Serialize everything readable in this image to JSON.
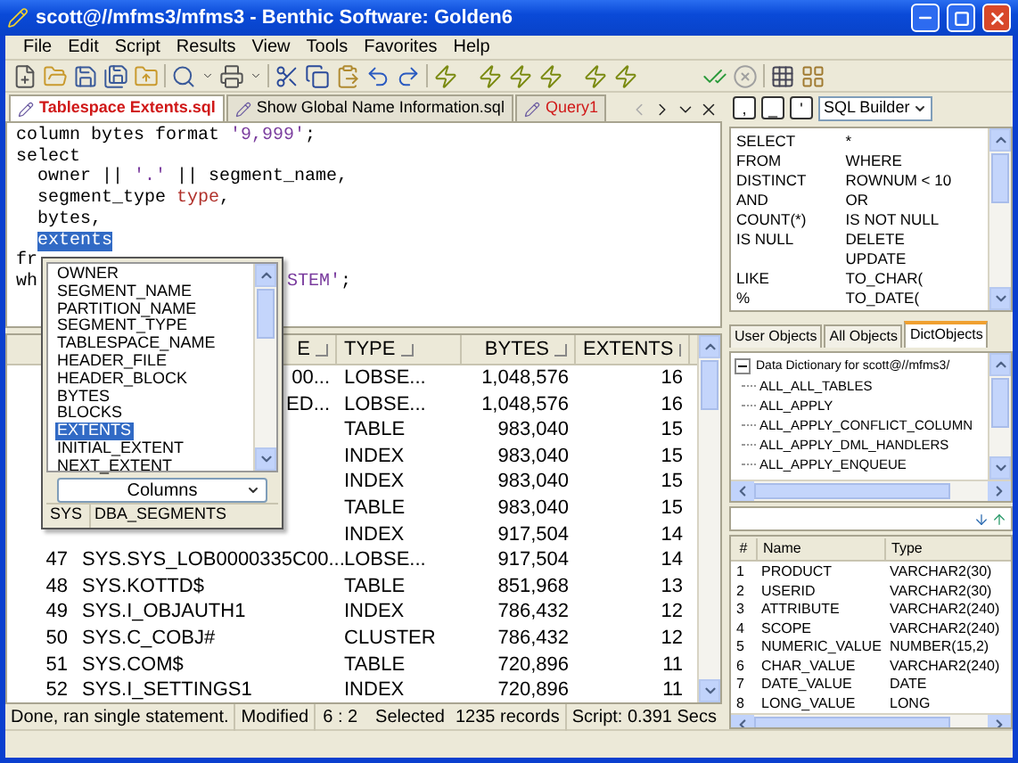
{
  "window": {
    "title": "scott@//mfms3/mfms3 - Benthic Software: Golden6"
  },
  "menu": [
    "File",
    "Edit",
    "Script",
    "Results",
    "View",
    "Tools",
    "Favorites",
    "Help"
  ],
  "editor_tabs": [
    {
      "label": "Tablespace Extents.sql",
      "selected": true,
      "modified": true
    },
    {
      "label": "Show Global Name Information.sql",
      "selected": false,
      "modified": false
    },
    {
      "label": "Query1",
      "selected": false,
      "modified": true
    }
  ],
  "editor": {
    "lines": [
      [
        {
          "text": "column bytes format ",
          "kind": "code"
        },
        {
          "text": "'9,999'",
          "kind": "string"
        },
        {
          "text": ";",
          "kind": "code"
        }
      ],
      [
        {
          "text": "select",
          "kind": "code"
        }
      ],
      [
        {
          "text": "  owner || ",
          "kind": "code"
        },
        {
          "text": "'.'",
          "kind": "string"
        },
        {
          "text": " || segment_name,",
          "kind": "code"
        }
      ],
      [
        {
          "text": "  segment_type ",
          "kind": "code"
        },
        {
          "text": "type",
          "kind": "alias"
        },
        {
          "text": ",",
          "kind": "code"
        }
      ],
      [
        {
          "text": "  bytes,",
          "kind": "code"
        }
      ],
      [
        {
          "text": "extents",
          "kind": "selected"
        }
      ],
      [
        {
          "text": "fr",
          "kind": "code"
        }
      ],
      [
        {
          "text": "wh",
          "kind": "code"
        },
        {
          "text": "STEM'",
          "kind": "tail"
        },
        {
          "text": ";",
          "kind": "code"
        }
      ]
    ]
  },
  "completion_popup": {
    "items": [
      {
        "label": "OWNER",
        "selected": false
      },
      {
        "label": "SEGMENT_NAME",
        "selected": false
      },
      {
        "label": "PARTITION_NAME",
        "selected": false
      },
      {
        "label": "SEGMENT_TYPE",
        "selected": false
      },
      {
        "label": "TABLESPACE_NAME",
        "selected": false
      },
      {
        "label": "HEADER_FILE",
        "selected": false
      },
      {
        "label": "HEADER_BLOCK",
        "selected": false
      },
      {
        "label": "BYTES",
        "selected": false
      },
      {
        "label": "BLOCKS",
        "selected": false
      },
      {
        "label": "EXTENTS",
        "selected": true
      },
      {
        "label": "INITIAL_EXTENT",
        "selected": false
      },
      {
        "label": "NEXT_EXTENT",
        "selected": false
      }
    ],
    "dropdown": "Columns",
    "owner": "SYS",
    "object": "DBA_SEGMENTS"
  },
  "results": {
    "columns": [
      "E",
      "TYPE",
      "BYTES",
      "EXTENTS"
    ],
    "rows": [
      {
        "segment_fragment": "00...",
        "type": "LOBSE...",
        "bytes": "1,048,576",
        "extents": "16"
      },
      {
        "segment_fragment": "ED...",
        "type": "LOBSE...",
        "bytes": "1,048,576",
        "extents": "16"
      },
      {
        "type": "TABLE",
        "bytes": "983,040",
        "extents": "15"
      },
      {
        "type": "INDEX",
        "bytes": "983,040",
        "extents": "15"
      },
      {
        "type": "INDEX",
        "bytes": "983,040",
        "extents": "15"
      },
      {
        "type": "TABLE",
        "bytes": "983,040",
        "extents": "15"
      },
      {
        "type": "INDEX",
        "bytes": "917,504",
        "extents": "14"
      },
      {
        "num": "47",
        "segment": "SYS.SYS_LOB0000335C00...",
        "type": "LOBSE...",
        "bytes": "917,504",
        "extents": "14"
      },
      {
        "num": "48",
        "segment": "SYS.KOTTD$",
        "type": "TABLE",
        "bytes": "851,968",
        "extents": "13"
      },
      {
        "num": "49",
        "segment": "SYS.I_OBJAUTH1",
        "type": "INDEX",
        "bytes": "786,432",
        "extents": "12"
      },
      {
        "num": "50",
        "segment": "SYS.C_COBJ#",
        "type": "CLUSTER",
        "bytes": "786,432",
        "extents": "12"
      },
      {
        "num": "51",
        "segment": "SYS.COM$",
        "type": "TABLE",
        "bytes": "720,896",
        "extents": "11"
      },
      {
        "num": "52",
        "segment": "SYS.I_SETTINGS1",
        "type": "INDEX",
        "bytes": "720,896",
        "extents": "11"
      }
    ]
  },
  "status_bar": {
    "message": "Done, ran single statement.",
    "modified_label": "Modified",
    "position": "6 : 2",
    "selected_label": "Selected",
    "records": "1235 records",
    "script_time": "Script: 0.391 Secs"
  },
  "sql_helper": {
    "buttons": [
      ",",
      "_",
      "'"
    ],
    "mode": "SQL Builder",
    "keywords": [
      {
        "left": "SELECT",
        "right": "*"
      },
      {
        "left": "FROM",
        "right": "WHERE"
      },
      {
        "left": "DISTINCT",
        "right": "ROWNUM < 10"
      },
      {
        "left": "AND",
        "right": "OR"
      },
      {
        "left": "COUNT(*)",
        "right": "IS NOT NULL"
      },
      {
        "left": "IS NULL",
        "right": "DELETE"
      },
      {
        "right": "UPDATE"
      },
      {
        "left": "LIKE",
        "right": "TO_CHAR("
      },
      {
        "left": "%",
        "right": "TO_DATE("
      }
    ]
  },
  "object_tabs": [
    {
      "label": "User Objects",
      "selected": false
    },
    {
      "label": "All Objects",
      "selected": false
    },
    {
      "label": "DictObjects",
      "selected": true
    }
  ],
  "tree": {
    "label": "Data Dictionary for scott@//mfms3/",
    "expanded": true,
    "children": [
      {
        "label": "ALL_ALL_TABLES"
      },
      {
        "label": "ALL_APPLY"
      },
      {
        "label": "ALL_APPLY_CONFLICT_COLUMN"
      },
      {
        "label": "ALL_APPLY_DML_HANDLERS"
      },
      {
        "label": "ALL_APPLY_ENQUEUE"
      }
    ]
  },
  "columns_table": {
    "columns": [
      "#",
      "Name",
      "Type"
    ],
    "rows": [
      {
        "num": "1",
        "name": "PRODUCT",
        "type": "VARCHAR2(30)"
      },
      {
        "num": "2",
        "name": "USERID",
        "type": "VARCHAR2(30)"
      },
      {
        "num": "3",
        "name": "ATTRIBUTE",
        "type": "VARCHAR2(240)"
      },
      {
        "num": "4",
        "name": "SCOPE",
        "type": "VARCHAR2(240)"
      },
      {
        "num": "5",
        "name": "NUMERIC_VALUE",
        "type": "NUMBER(15,2)"
      },
      {
        "num": "6",
        "name": "CHAR_VALUE",
        "type": "VARCHAR2(240)"
      },
      {
        "num": "7",
        "name": "DATE_VALUE",
        "type": "DATE"
      },
      {
        "num": "8",
        "name": "LONG_VALUE",
        "type": "LONG"
      }
    ]
  }
}
